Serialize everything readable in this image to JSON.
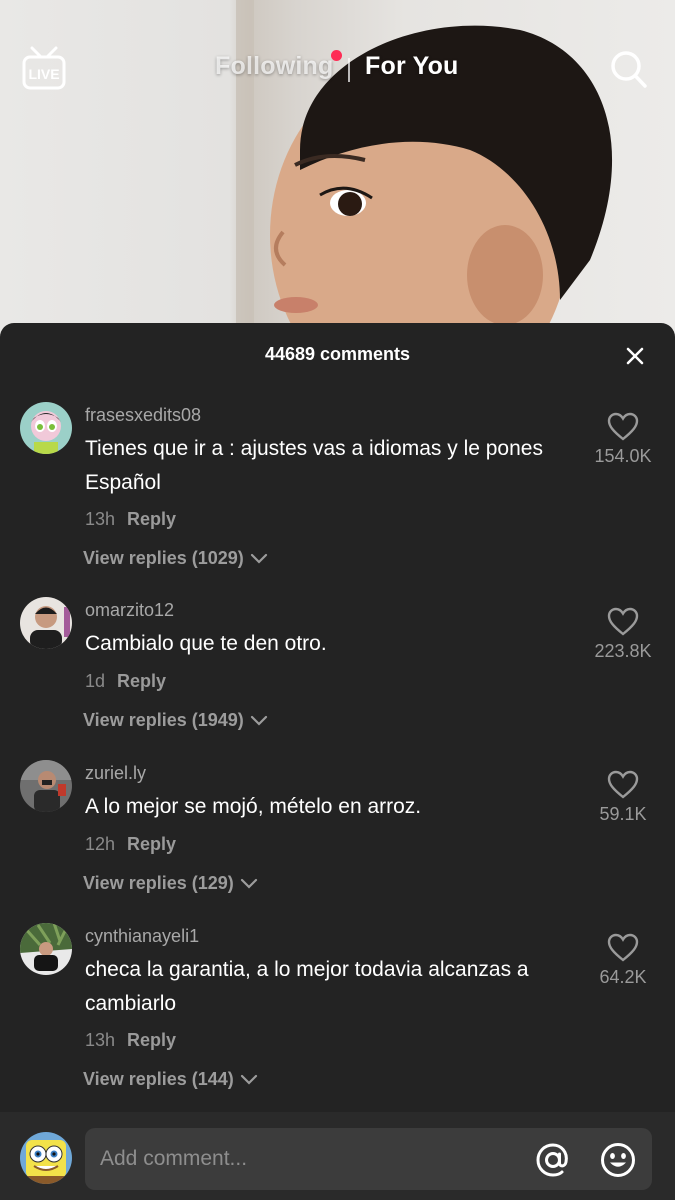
{
  "topnav": {
    "live_label": "LIVE",
    "following_label": "Following",
    "foryou_label": "For You",
    "notification_color": "#fe2c55"
  },
  "comments_panel": {
    "count_label": "44689 comments",
    "close_icon": "close-icon"
  },
  "comments": [
    {
      "username": "frasesxedits08",
      "text": "Tienes que ir a : ajustes vas a idiomas y le pones Español",
      "time": "13h",
      "reply_label": "Reply",
      "view_replies": "View replies (1029)",
      "likes": "154.0K"
    },
    {
      "username": "omarzito12",
      "text": "Cambialo que te den otro.",
      "time": "1d",
      "reply_label": "Reply",
      "view_replies": "View replies (1949)",
      "likes": "223.8K"
    },
    {
      "username": "zuriel.ly",
      "text": "A lo mejor se mojó, mételo en arroz.",
      "time": "12h",
      "reply_label": "Reply",
      "view_replies": "View replies (129)",
      "likes": "59.1K"
    },
    {
      "username": "cynthianayeli1",
      "text": "checa la garantia, a lo mejor todavia alcanzas a cambiarlo",
      "time": "13h",
      "reply_label": "Reply",
      "view_replies": "View replies (144)",
      "likes": "64.2K"
    }
  ],
  "input": {
    "placeholder": "Add comment..."
  },
  "colors": {
    "sheet_bg": "#232323",
    "input_bg": "#3c3c3c",
    "accent": "#fe2c55"
  }
}
